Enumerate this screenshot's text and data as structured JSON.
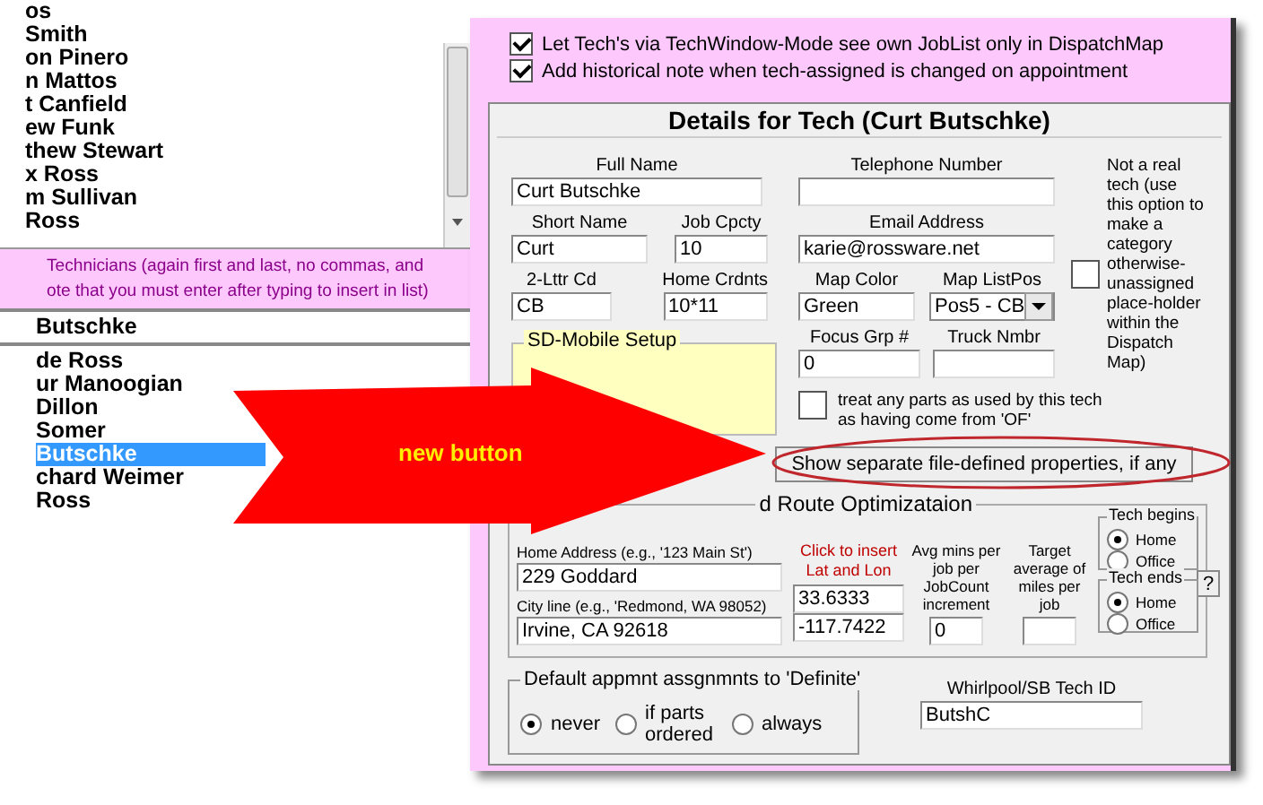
{
  "technician_list": {
    "items": [
      {
        "name": "os",
        "selected": false
      },
      {
        "name": "Smith",
        "selected": false
      },
      {
        "name": "on Pinero",
        "selected": false
      },
      {
        "name": "n Mattos",
        "selected": false
      },
      {
        "name": "t Canfield",
        "selected": false
      },
      {
        "name": "ew Funk",
        "selected": false
      },
      {
        "name": "thew Stewart",
        "selected": false
      },
      {
        "name": "x Ross",
        "selected": false
      },
      {
        "name": "m Sullivan",
        "selected": false
      },
      {
        "name": "Ross",
        "selected": false
      }
    ]
  },
  "instructions": [
    "Technicians (again first and last, no commas, and",
    "ote that you must enter after typing to insert in list)"
  ],
  "name_field": {
    "value": "Butschke"
  },
  "technician_list_2": {
    "items": [
      {
        "name": "de Ross",
        "selected": false
      },
      {
        "name": "ur Manoogian",
        "selected": false
      },
      {
        "name": "Dillon",
        "selected": false
      },
      {
        "name": "Somer",
        "selected": false
      },
      {
        "name": "Butschke",
        "selected": true
      },
      {
        "name": "chard Weimer",
        "selected": false
      },
      {
        "name": "Ross",
        "selected": false
      }
    ]
  },
  "options": [
    {
      "label": "Let Tech's via TechWindow-Mode see own JobList only in DispatchMap",
      "checked": true
    },
    {
      "label": "Add historical note when tech-assigned is changed on appointment",
      "checked": true
    }
  ],
  "details": {
    "title": "Details for Tech (Curt Butschke)",
    "full_name": {
      "label": "Full Name",
      "value": "Curt Butschke"
    },
    "telephone": {
      "label": "Telephone Number"
    },
    "short_name": {
      "label": "Short Name",
      "value": "Curt"
    },
    "job_capacity": {
      "label": "Job Cpcty",
      "value": "10"
    },
    "email": {
      "label": "Email Address",
      "value": "karie@rossware.net"
    },
    "two_letter_code": {
      "label": "2-Lttr Cd",
      "value": "CB"
    },
    "home_coordinates": {
      "label": "Home Crdnts",
      "value": "10*11"
    },
    "map_color": {
      "label": "Map Color",
      "value": "Green"
    },
    "map_list_pos": {
      "label": "Map ListPos",
      "value": "Pos5 - CB"
    },
    "focus_group": {
      "label": "Focus Grp #",
      "value": "0"
    },
    "truck_number": {
      "label": "Truck Nmbr"
    },
    "not_real_tech": {
      "label": "Not a real tech (use this option to make a category otherwise-unassigned place-holder within the Dispatch Map)",
      "checked": false
    },
    "sd_mobile": {
      "legend": "SD-Mobile Setup"
    },
    "treat_parts": {
      "label": "treat any parts as used by this tech as having come from 'OF'",
      "checked": false
    },
    "properties_button": "Show separate file-defined properties, if any",
    "route": {
      "legend": "d Route Optimizataion",
      "home_address": {
        "label": "Home Address  (e.g., '123 Main St')",
        "value": "229 Goddard"
      },
      "city_line": {
        "label": "City line (e.g., 'Redmond, WA 98052)",
        "value": "Irvine, CA 92618"
      },
      "lat_lon_link": "Click to insert Lat and Lon",
      "latitude": "33.6333",
      "longitude": "-117.7422",
      "avg_mins": {
        "label": "Avg mins per job per JobCount increment",
        "value": "0"
      },
      "target_miles": {
        "label": "Target average of miles per job"
      },
      "tech_begins": {
        "legend": "Tech begins",
        "options": [
          {
            "label": "Home",
            "selected": true
          },
          {
            "label": "Office",
            "selected": false
          }
        ]
      },
      "tech_ends": {
        "legend": "Tech ends",
        "options": [
          {
            "label": "Home",
            "selected": true
          },
          {
            "label": "Office",
            "selected": false
          }
        ]
      },
      "help_button": "?"
    },
    "definite": {
      "legend": "Default appmnt assgnmnts to 'Definite'",
      "options": [
        {
          "label": "never",
          "selected": true
        },
        {
          "label": "if parts ordered",
          "selected": false
        },
        {
          "label": "always",
          "selected": false
        }
      ]
    },
    "whirlpool_id": {
      "label": "Whirlpool/SB Tech ID",
      "value": "ButshC"
    }
  },
  "annotation": {
    "label": "new button"
  }
}
